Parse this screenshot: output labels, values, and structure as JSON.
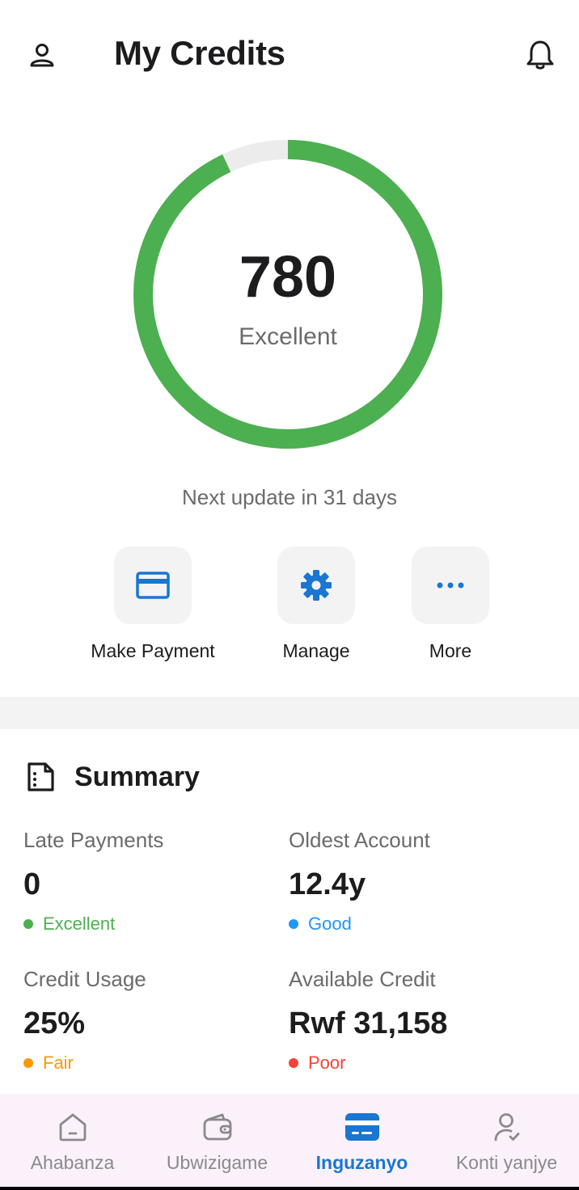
{
  "header": {
    "title": "My Credits",
    "profile_icon": "person-icon",
    "bell_icon": "bell-icon"
  },
  "score": {
    "value": "780",
    "label": "Excellent",
    "ring_fill_fraction": 0.93,
    "ring_color": "#4caf50",
    "track_color": "#ececec"
  },
  "next_update": "Next update in 31 days",
  "actions": [
    {
      "label": "Make Payment",
      "icon": "credit-card-icon"
    },
    {
      "label": "Manage",
      "icon": "gear-icon"
    },
    {
      "label": "More",
      "icon": "more-dots-icon"
    }
  ],
  "summary": {
    "title": "Summary",
    "icon": "document-icon",
    "stats": [
      {
        "label": "Late Payments",
        "value": "0",
        "status": "Excellent",
        "color": "#4caf50"
      },
      {
        "label": "Oldest Account",
        "value": "12.4y",
        "status": "Good",
        "color": "#2196f3"
      },
      {
        "label": "Credit Usage",
        "value": "25%",
        "status": "Fair",
        "color": "#ff9800"
      },
      {
        "label": "Available Credit",
        "value": "Rwf 31,158",
        "status": "Poor",
        "color": "#f44336"
      }
    ]
  },
  "nav": {
    "items": [
      {
        "label": "Ahabanza",
        "icon": "home-icon",
        "active": false
      },
      {
        "label": "Ubwizigame",
        "icon": "wallet-icon",
        "active": false
      },
      {
        "label": "Inguzanyo",
        "icon": "credit-card-icon",
        "active": true
      },
      {
        "label": "Konti yanjye",
        "icon": "account-check-icon",
        "active": false
      }
    ],
    "active_color": "#1976d2"
  },
  "accent_color": "#1976d2"
}
